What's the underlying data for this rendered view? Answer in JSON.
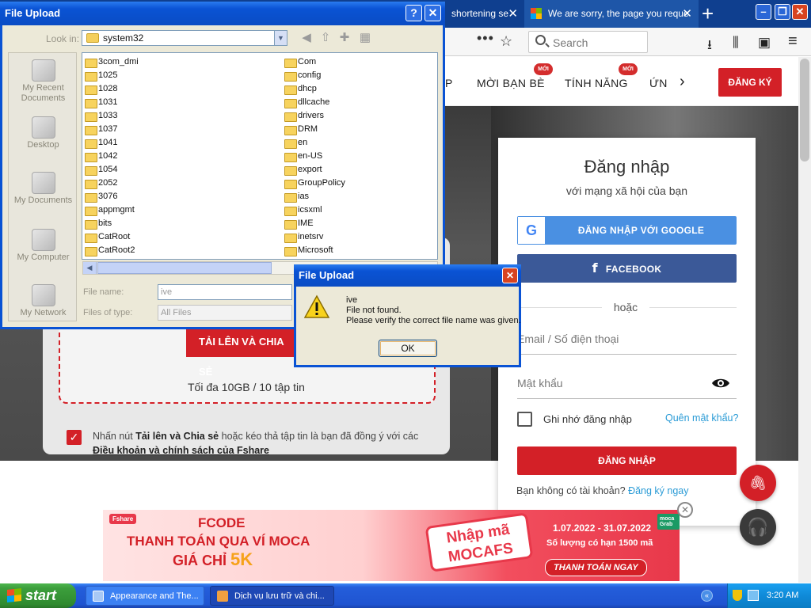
{
  "browser": {
    "tabs": [
      {
        "label": "shortening se",
        "close": "✕"
      },
      {
        "label": "We are sorry, the page you reque",
        "close": "✕"
      }
    ],
    "new_tab": "+",
    "window_controls": {
      "minimize": "–",
      "maximize": "❐",
      "close": "✕"
    },
    "toolbar": {
      "overflow": "•••",
      "bookmark": "☆",
      "search_placeholder": "Search",
      "download": "⭳",
      "library": "⫼",
      "sidebar": "▣",
      "menu": "≡"
    }
  },
  "site": {
    "menu": [
      {
        "label": "P"
      },
      {
        "label": "MỜI BẠN BÈ",
        "badge": "MỚI"
      },
      {
        "label": "TÍNH NĂNG",
        "badge": "MỚI"
      },
      {
        "label": "ỨN"
      }
    ],
    "menu_next": "›",
    "register_button": "ĐĂNG KÝ",
    "upload": {
      "button": "TẢI LÊN VÀ CHIA SẺ",
      "limit": "Tối đa 10GB / 10 tập tin",
      "terms_prefix": "Nhấn nút ",
      "terms_bold": "Tải lên và Chia sẻ",
      "terms_middle": " hoặc kéo thả tập tin là bạn đã đồng ý với các ",
      "terms_link": "Điều khoản và chính sách của Fshare",
      "checked": "✓"
    },
    "login": {
      "title": "Đăng nhập",
      "subtitle": "với mạng xã hội của bạn",
      "google_button": "ĐĂNG NHẬP VỚI GOOGLE",
      "google_glyph": "G",
      "facebook_button": "FACEBOOK",
      "facebook_glyph": "f",
      "or": "hoặc",
      "email_placeholder": "Email / Số điện thoại",
      "password_placeholder": "Mật khẩu",
      "remember": "Ghi nhớ đăng nhập",
      "forgot": "Quên mật khẩu?",
      "submit": "ĐĂNG NHẬP",
      "no_account": "Bạn không có tài khoản? ",
      "signup_link": "Đăng ký ngay"
    },
    "banner": {
      "brand": "Fshare",
      "line1": "FCODE",
      "line2": "THANH TOÁN QUA VÍ MOCA",
      "line3": "GIÁ CHỈ ",
      "price": "5K",
      "promo_label": "Nhập mã",
      "promo_code": "MOCAFS",
      "dates": "1.07.2022 - 31.07.2022",
      "quantity": "Số lượng có hạn 1500 mã",
      "cta": "THANH TOÁN NGAY",
      "partner": "moca Grab",
      "close": "✕"
    },
    "fab_attach": "🖇",
    "fab_support": "🎧"
  },
  "file_dialog": {
    "title": "File Upload",
    "help": "?",
    "close": "✕",
    "look_in_label": "Look in:",
    "look_in_value": "system32",
    "places": [
      {
        "label": "My Recent Documents"
      },
      {
        "label": "Desktop"
      },
      {
        "label": "My Documents"
      },
      {
        "label": "My Computer"
      },
      {
        "label": "My Network"
      }
    ],
    "files_col1": [
      "3com_dmi",
      "1025",
      "1028",
      "1031",
      "1033",
      "1037",
      "1041",
      "1042",
      "1054",
      "2052",
      "3076",
      "appmgmt",
      "bits",
      "CatRoot",
      "CatRoot2"
    ],
    "files_col2": [
      "Com",
      "config",
      "dhcp",
      "dllcache",
      "drivers",
      "DRM",
      "en",
      "en-US",
      "export",
      "GroupPolicy",
      "ias",
      "icsxml",
      "IME",
      "inetsrv",
      "Microsoft"
    ],
    "file_name_label": "File name:",
    "file_name_value": "ive",
    "file_type_label": "Files of type:",
    "file_type_value": "All Files"
  },
  "error_dialog": {
    "title": "File Upload",
    "close": "✕",
    "line1": "ive",
    "line2": "File not found.",
    "line3": "Please verify the correct file name was given.",
    "ok": "OK"
  },
  "taskbar": {
    "start": "start",
    "tasks": [
      "Appearance and The...",
      "Dịch vụ lưu trữ và chi..."
    ],
    "clock": "3:20 AM",
    "tray_toggle": "«"
  }
}
